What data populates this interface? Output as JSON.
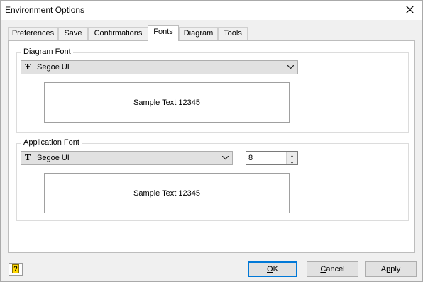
{
  "window": {
    "title": "Environment Options"
  },
  "tabs": [
    {
      "label": "Preferences"
    },
    {
      "label": "Save"
    },
    {
      "label": "Confirmations"
    },
    {
      "label": "Fonts"
    },
    {
      "label": "Diagram"
    },
    {
      "label": "Tools"
    }
  ],
  "active_tab": "Fonts",
  "diagram_font": {
    "group_label": "Diagram Font",
    "font_name": "Segoe UI",
    "sample_text": "Sample Text 12345"
  },
  "application_font": {
    "group_label": "Application Font",
    "font_name": "Segoe UI",
    "size": "8",
    "sample_text": "Sample Text 12345"
  },
  "buttons": {
    "ok": {
      "accel": "O",
      "rest": "K"
    },
    "cancel": {
      "accel": "C",
      "rest": "ancel"
    },
    "apply": {
      "pre": "A",
      "accel": "p",
      "rest": "ply"
    },
    "help_icon": "?"
  },
  "icons": {
    "font_icon": "Ŧ",
    "close": "close-icon",
    "chevron": "chevron-down-icon"
  },
  "colors": {
    "accent": "#0078d7",
    "help_yellow": "#ffd900"
  }
}
